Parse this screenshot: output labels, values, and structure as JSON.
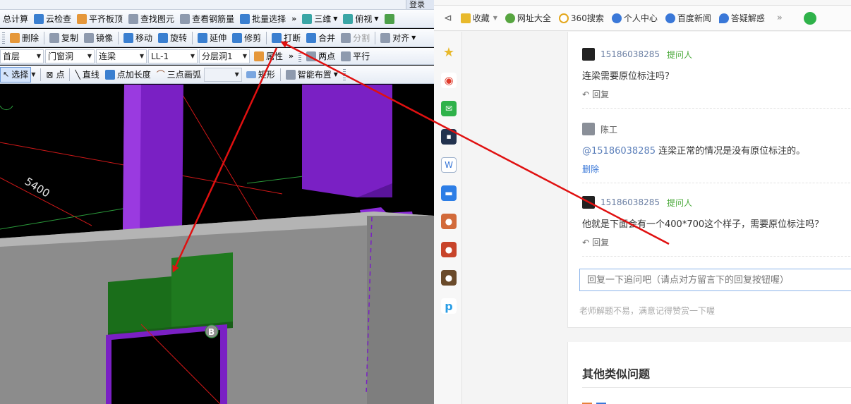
{
  "cad": {
    "toolbar1": {
      "total": "总计算",
      "cloud_check": "云检查",
      "flush_slab": "平齐板顶",
      "find_element": "查找图元",
      "view_rebar": "查看钢筋量",
      "batch_select": "批量选择",
      "view_3d": "三维",
      "view_top": "俯视"
    },
    "toolbar2": {
      "delete": "删除",
      "copy": "复制",
      "mirror": "镜像",
      "move": "移动",
      "rotate": "旋转",
      "extend": "延伸",
      "trim": "修剪",
      "break": "打断",
      "merge": "合并",
      "split": "分割",
      "align": "对齐"
    },
    "toolbar3": {
      "floor": "首层",
      "category": "门窗洞",
      "component_type": "连梁",
      "component": "LL-1",
      "layer": "分层洞1",
      "properties": "属性",
      "two_points": "两点",
      "parallel": "平行"
    },
    "toolbar4": {
      "select": "选择",
      "point": "点",
      "line": "直线",
      "point_length": "点加长度",
      "arc": "三点画弧",
      "arc_option": "",
      "rect": "矩形",
      "smart_layout": "智能布置"
    },
    "viewport": {
      "dimension_label": "5400",
      "axis_label": "B"
    },
    "top_fragment": "登录"
  },
  "browser": {
    "bookmarks": [
      {
        "label": "收藏",
        "icon": "star-icon",
        "color": "#e8b92c"
      },
      {
        "label": "网址大全",
        "icon": "plus-circle-icon",
        "color": "#57a540"
      },
      {
        "label": "360搜索",
        "icon": "ring-icon",
        "color": "#e3a71c"
      },
      {
        "label": "个人中心",
        "icon": "paw-icon",
        "color": "#3a78d8"
      },
      {
        "label": "百度新闻",
        "icon": "paw-icon",
        "color": "#3a78d8"
      },
      {
        "label": "答疑解惑",
        "icon": "bulb-icon",
        "color": "#3a78d8"
      }
    ],
    "comments": [
      {
        "user": "15186038285",
        "role": "提问人",
        "text": "连梁需要原位标注吗？",
        "action": "回复"
      },
      {
        "user": "陈工",
        "role": "",
        "mention": "@15186038285",
        "text": " 连梁正常的情况是没有原位标注的。",
        "action": "删除"
      },
      {
        "user": "15186038285",
        "role": "提问人",
        "text": "他就是下面会有一个400*700这个样子，需要原位标注吗？",
        "action": "回复"
      }
    ],
    "reply_placeholder": "回复一下追问吧（请点对方留言下的回复按钮喔）",
    "hint": "老师解题不易，满意记得赞赏一下喔",
    "other_title": "其他类似问题",
    "colors": {
      "accent": "#5b7fba",
      "asker": "#4aa93a",
      "arrow": "#e01010"
    }
  }
}
